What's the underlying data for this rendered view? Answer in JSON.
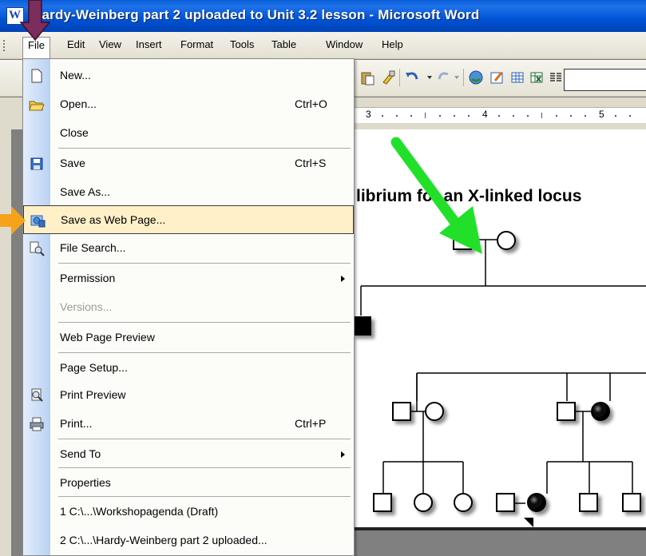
{
  "window": {
    "title": "Hardy-Weinberg part 2 uploaded to Unit 3.2 lesson - Microsoft Word"
  },
  "menubar": {
    "items": [
      {
        "label": "File"
      },
      {
        "label": "Edit"
      },
      {
        "label": "View"
      },
      {
        "label": "Insert"
      },
      {
        "label": "Format"
      },
      {
        "label": "Tools"
      },
      {
        "label": "Table"
      },
      {
        "label": "Window"
      },
      {
        "label": "Help"
      }
    ]
  },
  "ruler": {
    "numbers": [
      "3",
      "4",
      "5"
    ]
  },
  "file_menu": {
    "items": [
      {
        "label": "New...",
        "shortcut": ""
      },
      {
        "label": "Open...",
        "shortcut": "Ctrl+O"
      },
      {
        "label": "Close",
        "shortcut": ""
      },
      {
        "label": "Save",
        "shortcut": "Ctrl+S"
      },
      {
        "label": "Save As...",
        "shortcut": ""
      },
      {
        "label": "Save as Web Page...",
        "shortcut": ""
      },
      {
        "label": "File Search...",
        "shortcut": ""
      },
      {
        "label": "Permission",
        "shortcut": ""
      },
      {
        "label": "Versions...",
        "shortcut": ""
      },
      {
        "label": "Web Page Preview",
        "shortcut": ""
      },
      {
        "label": "Page Setup...",
        "shortcut": ""
      },
      {
        "label": "Print Preview",
        "shortcut": ""
      },
      {
        "label": "Print...",
        "shortcut": "Ctrl+P"
      },
      {
        "label": "Send To",
        "shortcut": ""
      },
      {
        "label": "Properties",
        "shortcut": ""
      },
      {
        "label": "1 C:\\...\\Workshopagenda (Draft)",
        "shortcut": ""
      },
      {
        "label": "2 C:\\...\\Hardy-Weinberg part 2 uploaded...",
        "shortcut": ""
      }
    ]
  },
  "document": {
    "heading": "librium for an X-linked locus"
  },
  "colors": {
    "title_bar": "#0053d6",
    "highlight": "#fff0c8",
    "purple_arrow": "#7b2d5c",
    "orange_arrow": "#f7a21b",
    "green_arrow": "#22e02a"
  }
}
